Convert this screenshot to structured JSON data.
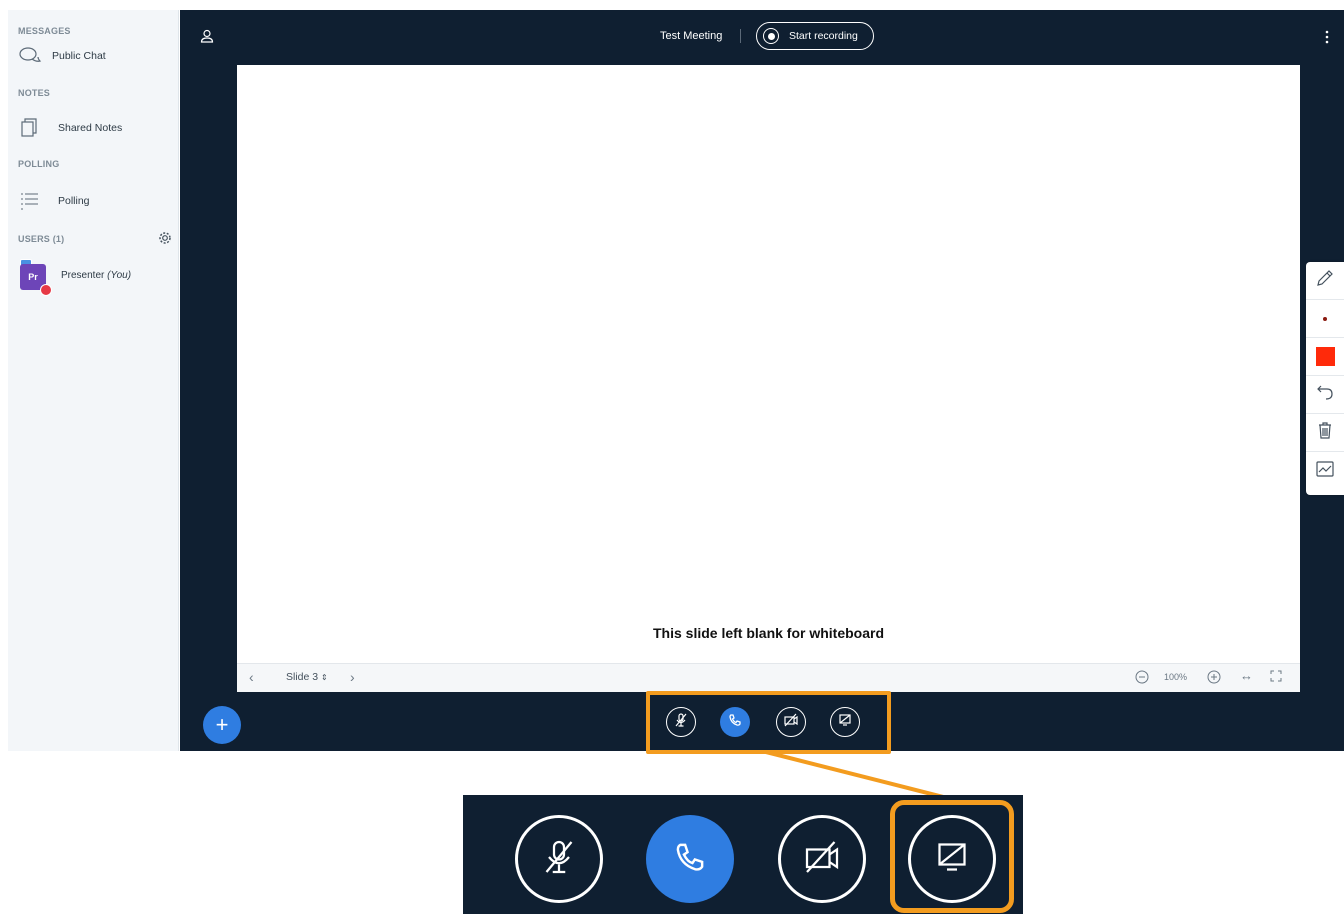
{
  "sidebar": {
    "messages_title": "MESSAGES",
    "public_chat": "Public Chat",
    "notes_title": "NOTES",
    "shared_notes": "Shared Notes",
    "polling_title": "POLLING",
    "polling": "Polling",
    "users_title": "USERS (1)",
    "user": {
      "initials": "Pr",
      "name": "Presenter",
      "tag": "(You)"
    }
  },
  "header": {
    "meeting_title": "Test Meeting",
    "record_label": "Start recording"
  },
  "slide": {
    "caption": "This slide left blank for whiteboard",
    "current": "Slide 3",
    "zoom": "100%"
  },
  "colors": {
    "accent": "#2f7de1",
    "highlight": "#f39c1f",
    "pen_color": "#ff2a0a",
    "dark_bg": "#0f1f31"
  },
  "actions": {
    "add": "+",
    "icons": [
      "microphone-muted-icon",
      "phone-icon",
      "video-off-icon",
      "screen-share-off-icon"
    ]
  }
}
